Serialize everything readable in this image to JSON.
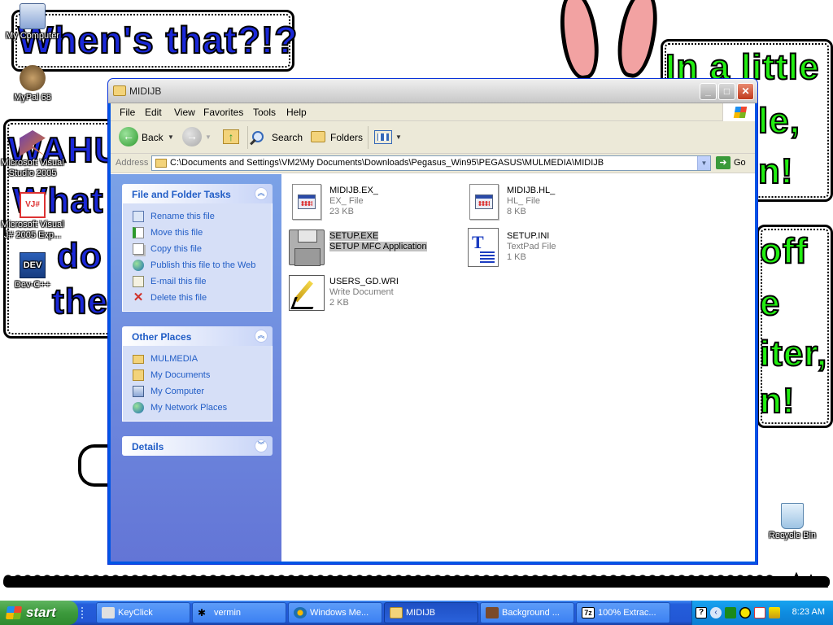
{
  "wallpaper": {
    "bubble1": "When's that?!?",
    "bubble2_lines": [
      "WAHU",
      "What",
      "do",
      "the"
    ],
    "bubble3_lines": [
      "In a little",
      "le,",
      "n!"
    ],
    "bubble4_lines": [
      "off",
      "e",
      "iter,",
      "n!"
    ],
    "colors": {
      "blue_text": "#1a28d8",
      "green_text": "#22ee11",
      "ear": "#f2a2a2"
    }
  },
  "desktop_icons": [
    {
      "label": "My Computer",
      "icon": "my-computer-icon"
    },
    {
      "label": "MyPal 68",
      "icon": "mypal-icon"
    },
    {
      "label": "Microsoft Visual Studio 2005",
      "icon": "visual-studio-icon"
    },
    {
      "label": "Microsoft Visual J# 2005 Exp...",
      "icon": "visual-jsharp-icon"
    },
    {
      "label": "Dev-C++",
      "icon": "dev-cpp-icon"
    },
    {
      "label": "Recycle Bin",
      "icon": "recycle-bin-icon"
    }
  ],
  "window": {
    "title": "MIDIJB",
    "menu": [
      "File",
      "Edit",
      "View",
      "Favorites",
      "Tools",
      "Help"
    ],
    "toolbar": {
      "back": "Back",
      "search": "Search",
      "folders": "Folders"
    },
    "address": {
      "label": "Address",
      "value": "C:\\Documents and Settings\\VM2\\My Documents\\Downloads\\Pegasus_Win95\\PEGASUS\\MULMEDIA\\MIDIJB",
      "go": "Go"
    },
    "file_tasks": {
      "title": "File and Folder Tasks",
      "items": [
        {
          "label": "Rename this file",
          "icon": "rename-icon"
        },
        {
          "label": "Move this file",
          "icon": "move-icon"
        },
        {
          "label": "Copy this file",
          "icon": "copy-icon"
        },
        {
          "label": "Publish this file to the Web",
          "icon": "publish-web-icon"
        },
        {
          "label": "E-mail this file",
          "icon": "email-icon"
        },
        {
          "label": "Delete this file",
          "icon": "delete-icon"
        }
      ]
    },
    "other_places": {
      "title": "Other Places",
      "items": [
        {
          "label": "MULMEDIA",
          "icon": "folder-icon"
        },
        {
          "label": "My Documents",
          "icon": "my-documents-icon"
        },
        {
          "label": "My Computer",
          "icon": "my-computer-icon"
        },
        {
          "label": "My Network Places",
          "icon": "network-places-icon"
        }
      ]
    },
    "details": {
      "title": "Details"
    },
    "files": [
      {
        "name": "MIDIJB.EX_",
        "type": "EX_ File",
        "size": "23 KB",
        "icon": "system-file-icon",
        "selected": false
      },
      {
        "name": "MIDIJB.HL_",
        "type": "HL_ File",
        "size": "8 KB",
        "icon": "system-file-icon",
        "selected": false
      },
      {
        "name": "SETUP.EXE",
        "type": "SETUP MFC Application",
        "size": "",
        "icon": "floppy-setup-icon",
        "selected": true
      },
      {
        "name": "SETUP.INI",
        "type": "TextPad File",
        "size": "1 KB",
        "icon": "textpad-file-icon",
        "selected": false
      },
      {
        "name": "USERS_GD.WRI",
        "type": "Write Document",
        "size": "2 KB",
        "icon": "write-document-icon",
        "selected": false
      }
    ]
  },
  "taskbar": {
    "start": "start",
    "buttons": [
      {
        "label": "KeyClick",
        "icon": "keyclick-icon"
      },
      {
        "label": "vermin",
        "icon": "vermin-icon"
      },
      {
        "label": "Windows Me...",
        "icon": "media-player-icon"
      },
      {
        "label": "MIDIJB",
        "icon": "folder-icon"
      },
      {
        "label": "Background ...",
        "icon": "background-icon"
      },
      {
        "label": "100% Extrac...",
        "icon": "7zip-icon"
      }
    ],
    "clock": "8:23 AM"
  }
}
